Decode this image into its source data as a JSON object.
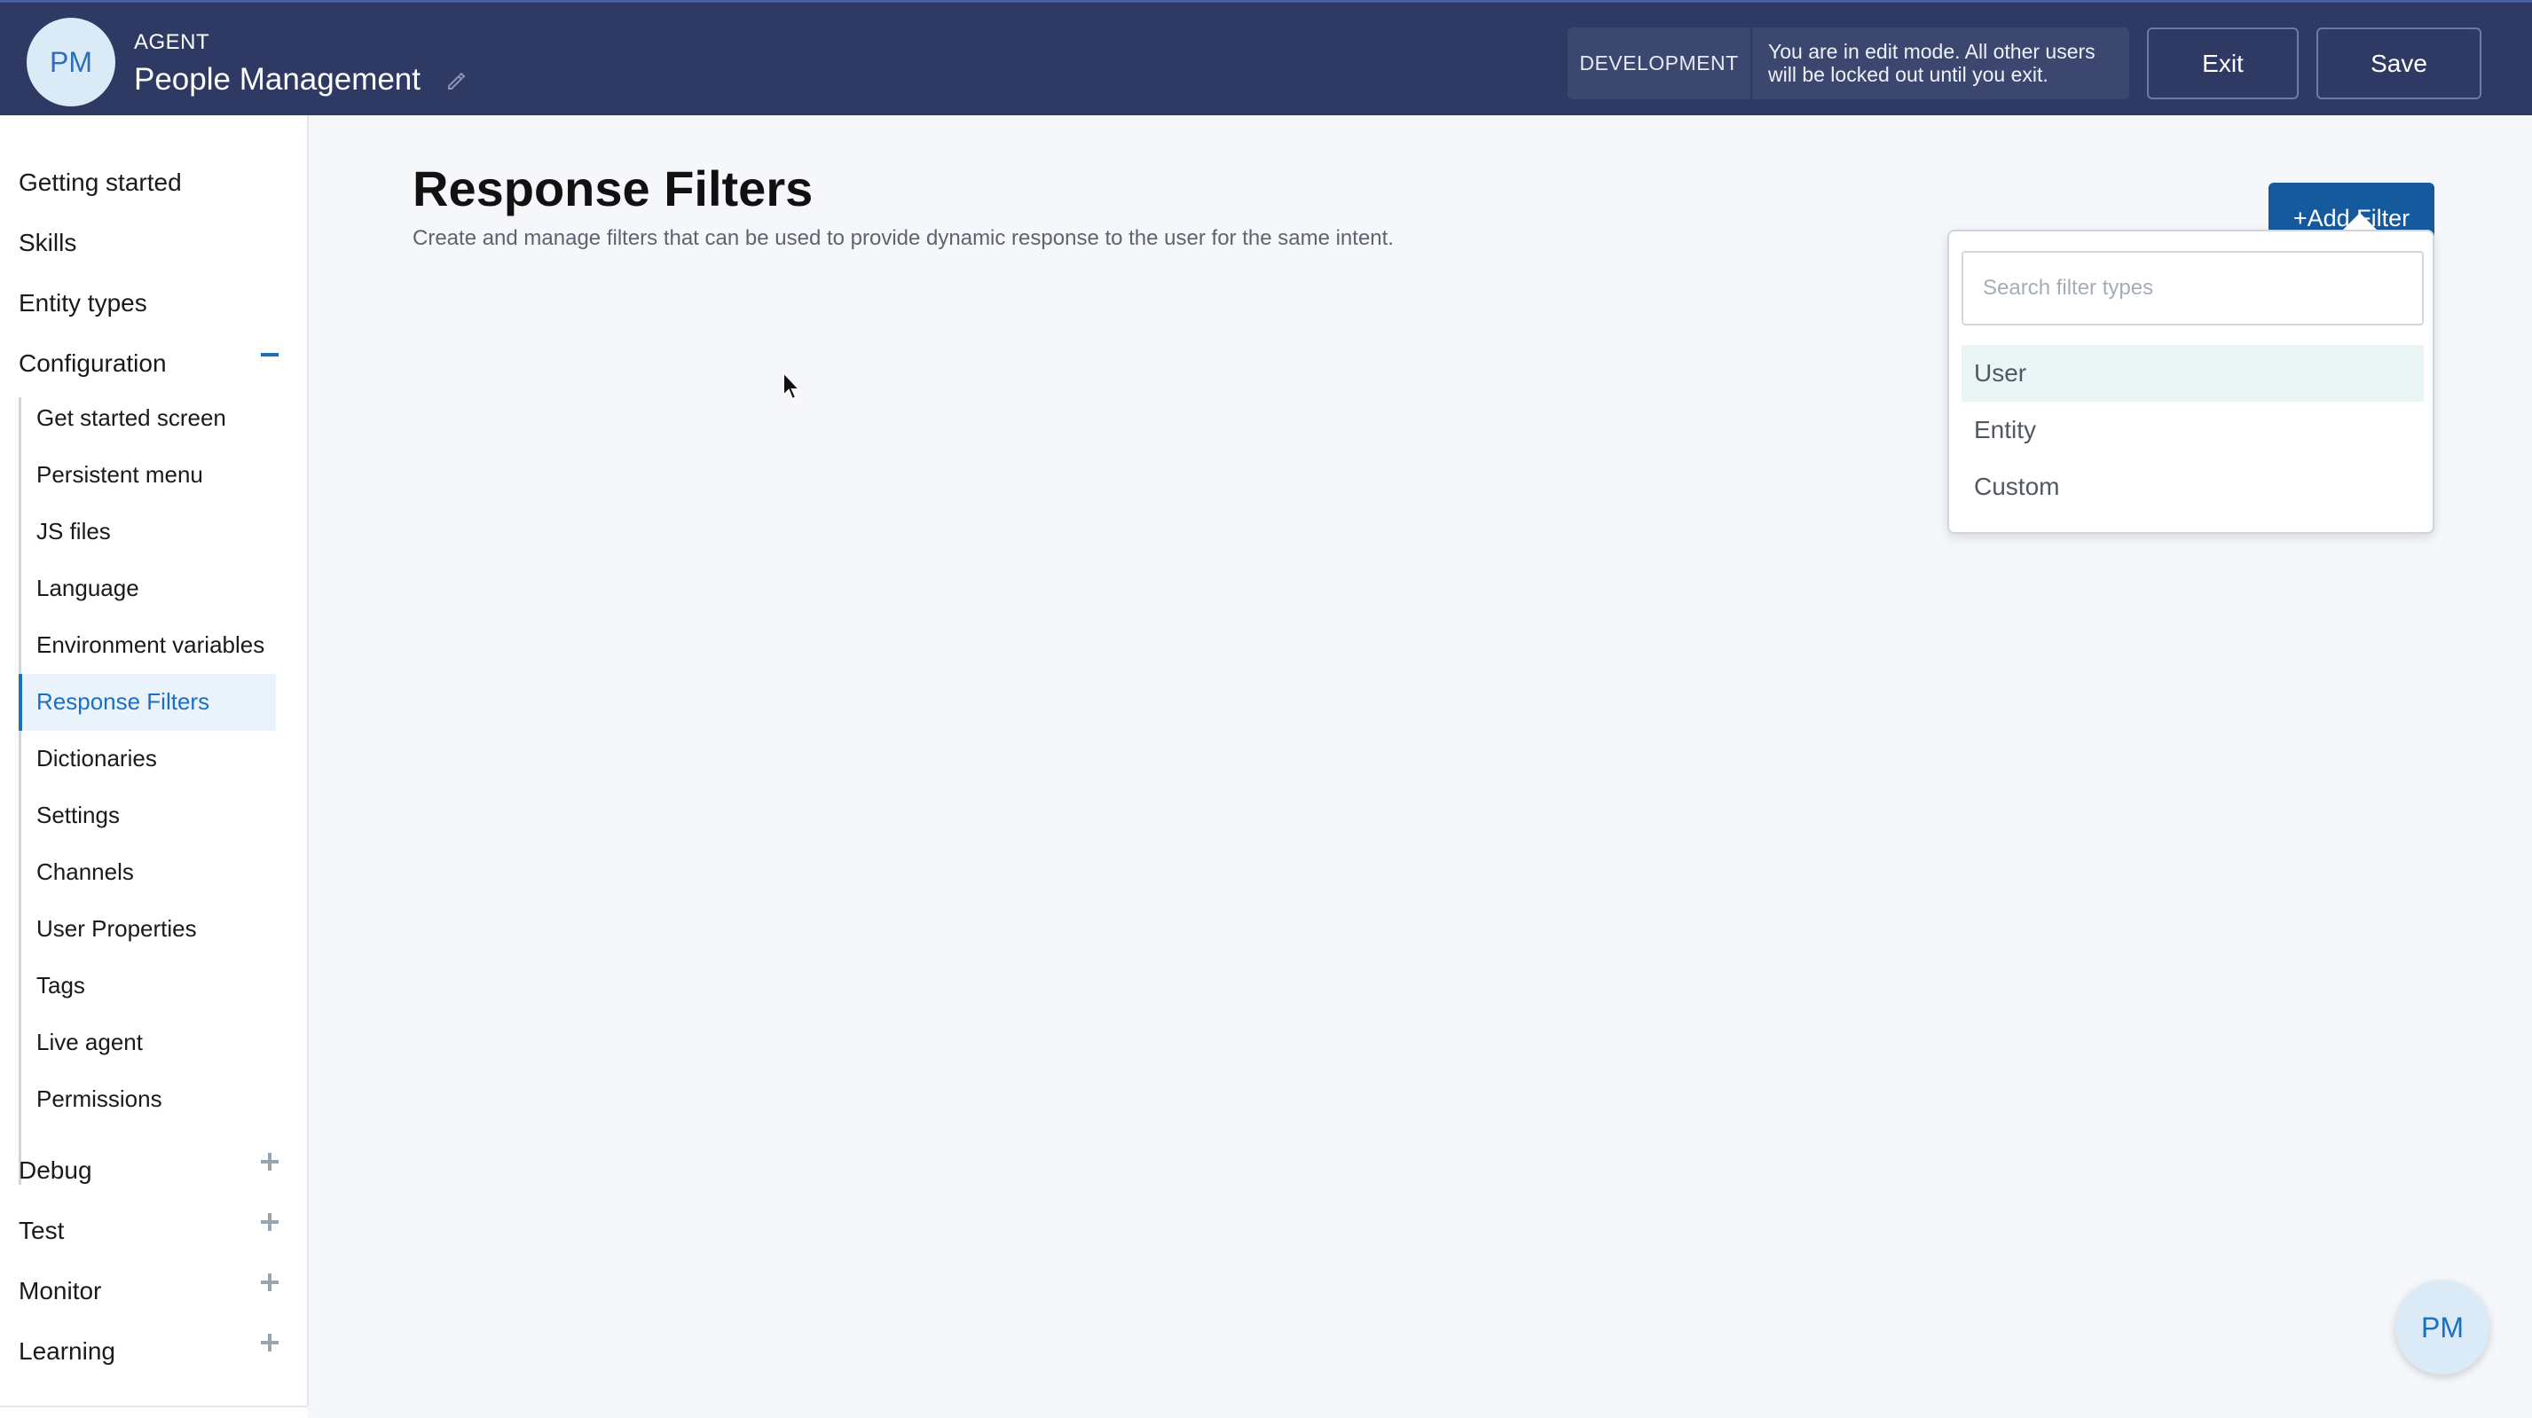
{
  "header": {
    "avatar_initials": "PM",
    "agent_label": "AGENT",
    "agent_name": "People Management",
    "env_tag": "DEVELOPMENT",
    "env_message": "You are in edit mode. All other users will be locked out until you exit.",
    "exit_label": "Exit",
    "save_label": "Save"
  },
  "sidebar": {
    "top": [
      "Getting started",
      "Skills",
      "Entity types",
      "Configuration"
    ],
    "sub": [
      "Get started screen",
      "Persistent menu",
      "JS files",
      "Language",
      "Environment variables",
      "Response Filters",
      "Dictionaries",
      "Settings",
      "Channels",
      "User Properties",
      "Tags",
      "Live agent",
      "Permissions"
    ],
    "bottom": [
      "Debug",
      "Test",
      "Monitor",
      "Learning"
    ],
    "active_item": "Response Filters"
  },
  "main": {
    "title": "Response Filters",
    "subtitle": "Create and manage filters that can be used to provide dynamic response to the user for the same intent.",
    "add_button": "+Add Filter"
  },
  "dropdown": {
    "search_placeholder": "Search filter types",
    "options": [
      "User",
      "Entity",
      "Custom"
    ],
    "highlighted": "User"
  },
  "fab": {
    "initials": "PM"
  },
  "colors": {
    "header_bg": "#2e3a63",
    "accent": "#1a6fc4",
    "primary_button": "#165a9e"
  }
}
